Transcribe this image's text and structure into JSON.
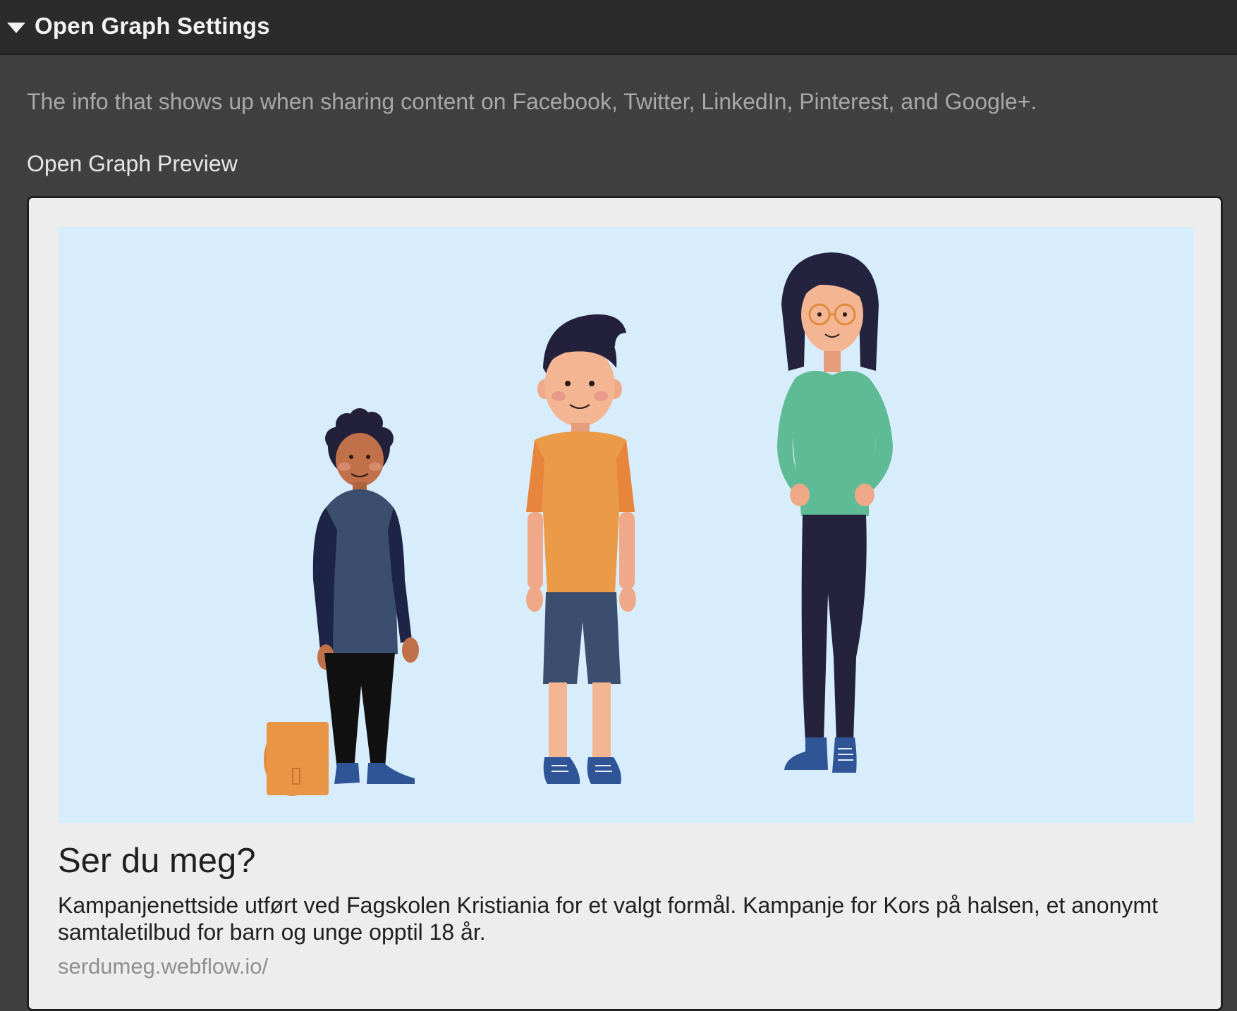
{
  "section": {
    "title": "Open Graph Settings",
    "expanded": true
  },
  "description": "The info that shows up when sharing content on Facebook, Twitter, LinkedIn, Pinterest, and Google+.",
  "preview_label": "Open Graph Preview",
  "preview": {
    "title": "Ser du meg?",
    "description": "Kampanjenettside utført ved Fagskolen Kristiania for et valgt formål. Kampanje for Kors på halsen, et anonymt samtaletilbud for barn og unge opptil 18 år.",
    "url": "serdumeg.webflow.io/"
  },
  "colors": {
    "header_bg": "#2b2b2b",
    "panel_bg": "#404040",
    "card_bg": "#ededed",
    "image_bg": "#d8edfc"
  },
  "icons": [
    "caret-down-icon"
  ]
}
